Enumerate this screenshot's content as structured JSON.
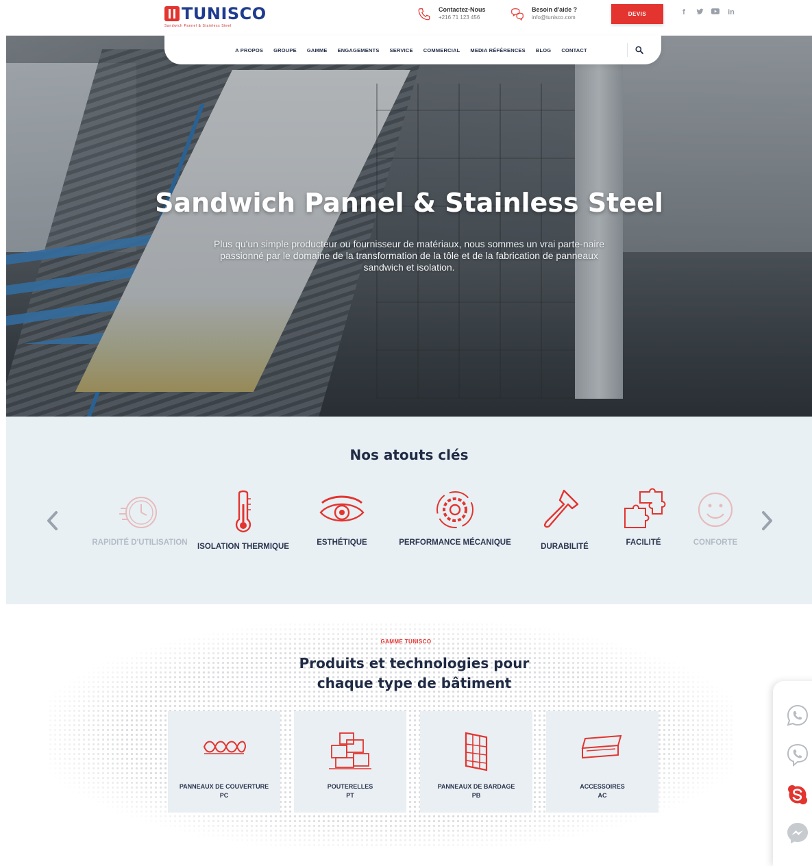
{
  "brand": {
    "name": "TUNISCO",
    "tagline": "Sandwich Pannel & Stainless Steel",
    "accent_color": "#e3342f",
    "primary_color": "#1f3b8f"
  },
  "header": {
    "contact": {
      "label": "Contactez-Nous",
      "value": "+216 71 123 456"
    },
    "help": {
      "label": "Besoin d'aide ?",
      "value": "info@tunisco.com"
    },
    "devis_button": "DEVIS",
    "social": [
      {
        "icon": "facebook-icon",
        "glyph": "f"
      },
      {
        "icon": "twitter-icon",
        "glyph": "🐦"
      },
      {
        "icon": "youtube-icon",
        "glyph": "▶"
      },
      {
        "icon": "linkedin-icon",
        "glyph": "in"
      }
    ]
  },
  "nav": {
    "items": [
      "A PROPOS",
      "GROUPE",
      "GAMME",
      "ENGAGEMENTS",
      "SERVICE",
      "COMMERCIAL",
      "MEDIA RÉFÉRENCES",
      "BLOG",
      "CONTACT"
    ],
    "search_icon": "search-icon"
  },
  "hero": {
    "title": "Sandwich Pannel & Stainless Steel",
    "subtitle": "Plus qu'un simple producteur ou fournisseur de matériaux, nous sommes un vrai parte-naire passionné par le domaine de la transformation de la tôle et de la fabrication de panneaux sandwich et isolation."
  },
  "atouts": {
    "title": "Nos atouts clés",
    "items": [
      {
        "label": "RAPIDITÉ D'UTILISATION",
        "icon": "stopwatch-icon",
        "faded": true
      },
      {
        "label": "ISOLATION THERMIQUE",
        "icon": "thermometer-icon",
        "faded": false
      },
      {
        "label": "ESTHÉTIQUE",
        "icon": "eye-icon",
        "faded": false
      },
      {
        "label": "PERFORMANCE MÉCANIQUE",
        "icon": "gear-icon",
        "faded": false
      },
      {
        "label": "DURABILITÉ",
        "icon": "hammer-icon",
        "faded": false
      },
      {
        "label": "FACILITÉ",
        "icon": "puzzle-icon",
        "faded": false
      },
      {
        "label": "CONFORTE",
        "icon": "smiley-icon",
        "faded": true
      }
    ]
  },
  "gamme": {
    "kicker": "GAMME TUNISCO",
    "title_line1": "Produits et technologies pour",
    "title_line2": "chaque type de bâtiment",
    "cards": [
      {
        "line1": "PANNEAUX DE COUVERTURE",
        "line2": "PC",
        "icon": "insulation-roll-icon"
      },
      {
        "line1": "POUTERELLES",
        "line2": "PT",
        "icon": "building-blocks-icon"
      },
      {
        "line1": "PANNEAUX DE BARDAGE",
        "line2": "PB",
        "icon": "wall-panel-icon"
      },
      {
        "line1": "ACCESSOIRES",
        "line2": "AC",
        "icon": "accessory-sheet-icon"
      }
    ]
  },
  "chat": [
    "whatsapp-icon",
    "viber-icon",
    "skype-icon",
    "messenger-icon"
  ]
}
